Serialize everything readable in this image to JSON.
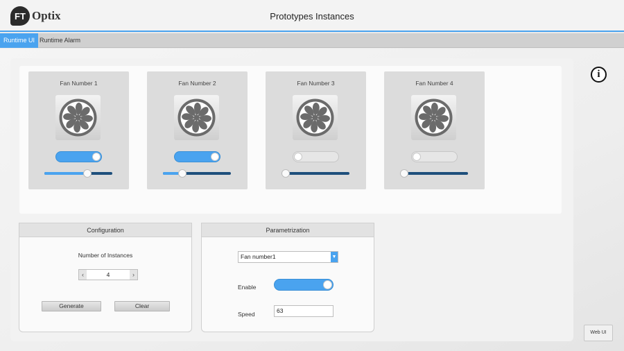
{
  "header": {
    "logo_mark": "FT",
    "logo_text": "Optix",
    "title": "Prototypes Instances"
  },
  "tabs": [
    {
      "label": "Runtime UI",
      "active": true
    },
    {
      "label": "Runtime Alarm",
      "active": false
    }
  ],
  "fans": [
    {
      "name": "Fan Number 1",
      "enabled": true,
      "speed_percent": 63
    },
    {
      "name": "Fan Number 2",
      "enabled": true,
      "speed_percent": 29
    },
    {
      "name": "Fan Number 3",
      "enabled": false,
      "speed_percent": 0
    },
    {
      "name": "Fan Number 4",
      "enabled": false,
      "speed_percent": 0
    }
  ],
  "configuration": {
    "title": "Configuration",
    "instances_label": "Number of Instances",
    "instances_value": "4",
    "generate_label": "Generate",
    "clear_label": "Clear"
  },
  "parametrization": {
    "title": "Parametrization",
    "selected_fan": "Fan number1",
    "enable_label": "Enable",
    "enabled": true,
    "speed_label": "Speed",
    "speed_value": "63"
  },
  "info_icon": "info-icon",
  "web_ui_label": "Web UI",
  "colors": {
    "accent": "#4aa3ef",
    "track_dark": "#1e4f7c",
    "fan_gray": "#6b6b6b"
  }
}
